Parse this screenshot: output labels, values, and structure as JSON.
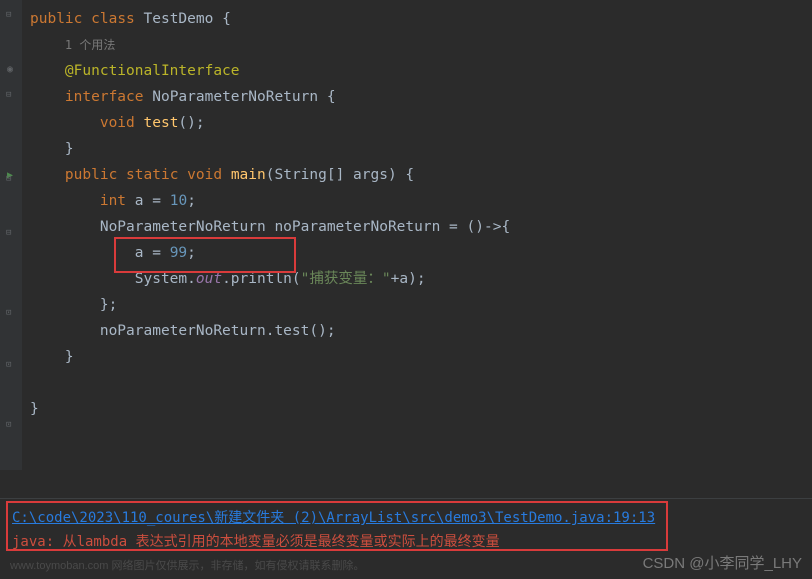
{
  "code": {
    "l1": {
      "public": "public",
      "class": "class",
      "name": "TestDemo",
      "brace": " {"
    },
    "l2": {
      "hint": "1 个用法"
    },
    "l3": {
      "annotation": "@FunctionalInterface"
    },
    "l4": {
      "interface": "interface",
      "name": "NoParameterNoReturn",
      "brace": " {"
    },
    "l5": {
      "void": "void",
      "name": "test",
      "parens": "();"
    },
    "l6": {
      "brace": "}"
    },
    "l7": {
      "public": "public",
      "static": "static",
      "void": "void",
      "name": "main",
      "params": "(String[] args)",
      "brace": " {"
    },
    "l8": {
      "int": "int",
      "var": "a",
      "eq": " = ",
      "num": "10",
      "semi": ";"
    },
    "l9": {
      "type": "NoParameterNoReturn",
      "var": "noParameterNoReturn",
      "eq": " = ",
      "lambda": "()->{",
      "close": ""
    },
    "l10": {
      "var": "a",
      "eq": " = ",
      "num": "99",
      "semi": ";"
    },
    "l11": {
      "system": "System.",
      "out": "out",
      "dot": ".println(",
      "str": "\"捕获变量：\"",
      "plus": "+",
      "var": "a",
      "close": ");"
    },
    "l12": {
      "brace": "};"
    },
    "l13": {
      "call": "noParameterNoReturn.test();"
    },
    "l14": {
      "brace": "}"
    },
    "l16": {
      "brace": "}"
    }
  },
  "console": {
    "link": "C:\\code\\2023\\110_coures\\新建文件夹 (2)\\ArrayList\\src\\demo3\\TestDemo.java:19:13",
    "error": "java: 从lambda 表达式引用的本地变量必须是最终变量或实际上的最终变量"
  },
  "watermark": "CSDN @小李同学_LHY",
  "faded": "www.toymoban.com 网络图片仅供展示，非存储，如有侵权请联系删除。"
}
